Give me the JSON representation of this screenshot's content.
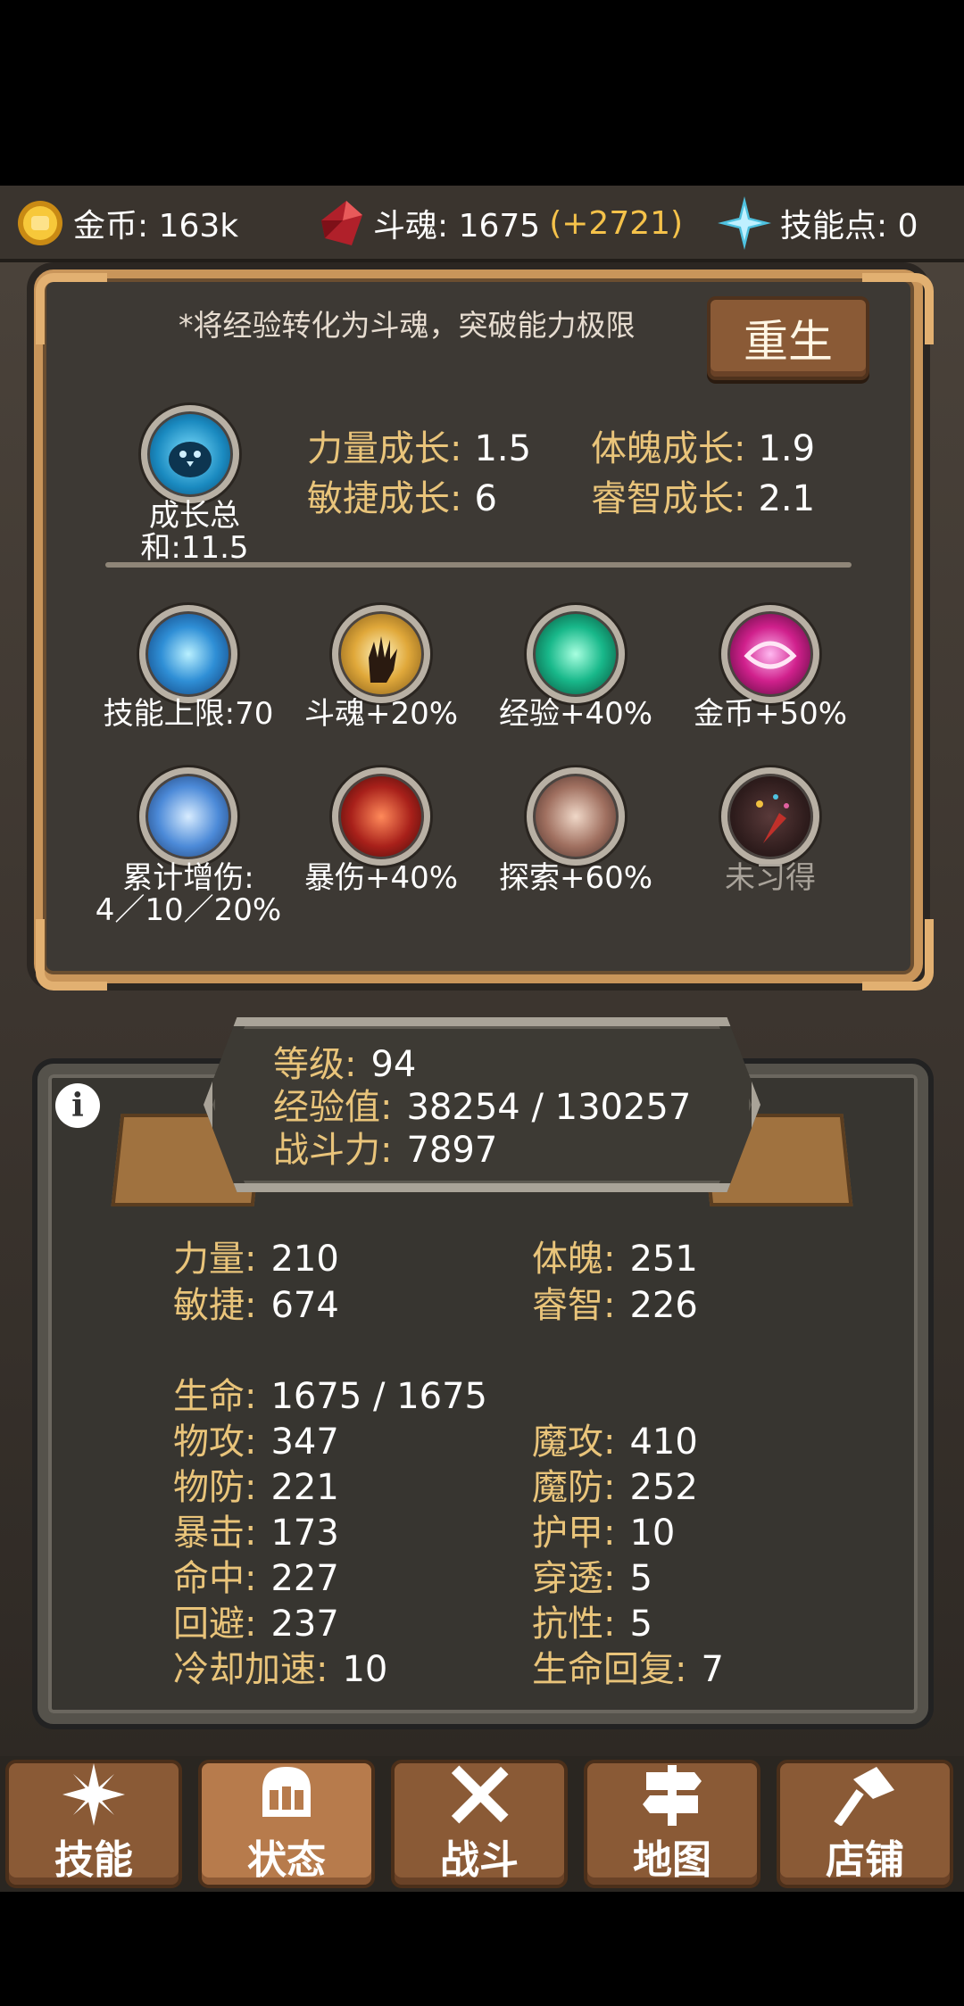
{
  "resources": {
    "gold_label": "金币: 163k",
    "soul_label": "斗魂: 1675",
    "soul_bonus": "(+2721)",
    "skillpoints_label": "技能点: 0"
  },
  "rebirth": {
    "hint": "*将经验转化为斗魂，突破能力极限",
    "button": "重生",
    "total_caption": "成长总和:11.5",
    "growth": [
      {
        "key": "力量成长:",
        "value": "1.5"
      },
      {
        "key": "体魄成长:",
        "value": "1.9"
      },
      {
        "key": "敏捷成长:",
        "value": "6"
      },
      {
        "key": "睿智成长:",
        "value": "2.1"
      }
    ],
    "perks": [
      {
        "label": "技能上限:70",
        "icon": "skill-cap-icon"
      },
      {
        "label": "斗魂+20%",
        "icon": "soul-hand-icon"
      },
      {
        "label": "经验+40%",
        "icon": "exp-swirl-icon"
      },
      {
        "label": "金币+50%",
        "icon": "gold-eye-icon"
      },
      {
        "label": "累计增伤:",
        "label2": "4／10／20%",
        "icon": "sword-strike-icon"
      },
      {
        "label": "暴伤+40%",
        "icon": "crit-warrior-icon"
      },
      {
        "label": "探索+60%",
        "icon": "horse-icon"
      },
      {
        "label": "未习得",
        "icon": "fireworks-icon"
      }
    ]
  },
  "profile": {
    "level_key": "等级:",
    "level": "94",
    "exp_key": "经验值:",
    "exp": "38254 / 130257",
    "power_key": "战斗力:",
    "power": "7897"
  },
  "stats": {
    "attrs": [
      {
        "key": "力量:",
        "value": "210"
      },
      {
        "key": "体魄:",
        "value": "251"
      },
      {
        "key": "敏捷:",
        "value": "674"
      },
      {
        "key": "睿智:",
        "value": "226"
      }
    ],
    "hp_key": "生命:",
    "hp": "1675 / 1675",
    "combat": [
      {
        "key": "物攻:",
        "value": "347"
      },
      {
        "key": "魔攻:",
        "value": "410"
      },
      {
        "key": "物防:",
        "value": "221"
      },
      {
        "key": "魔防:",
        "value": "252"
      },
      {
        "key": "暴击:",
        "value": "173"
      },
      {
        "key": "护甲:",
        "value": "10"
      },
      {
        "key": "命中:",
        "value": "227"
      },
      {
        "key": "穿透:",
        "value": "5"
      },
      {
        "key": "回避:",
        "value": "237"
      },
      {
        "key": "抗性:",
        "value": "5"
      },
      {
        "key": "冷却加速:",
        "value": "10"
      },
      {
        "key": "生命回复:",
        "value": "7"
      }
    ]
  },
  "nav": [
    {
      "label": "技能",
      "icon": "sparkle-icon"
    },
    {
      "label": "状态",
      "icon": "helmet-icon"
    },
    {
      "label": "战斗",
      "icon": "crossed-swords-icon"
    },
    {
      "label": "地图",
      "icon": "signpost-icon"
    },
    {
      "label": "店铺",
      "icon": "hammer-icon"
    }
  ],
  "colors": {
    "accent_gold": "#e9c47a",
    "frame_orange": "#c9955a",
    "button_brown": "#8a5a36"
  }
}
